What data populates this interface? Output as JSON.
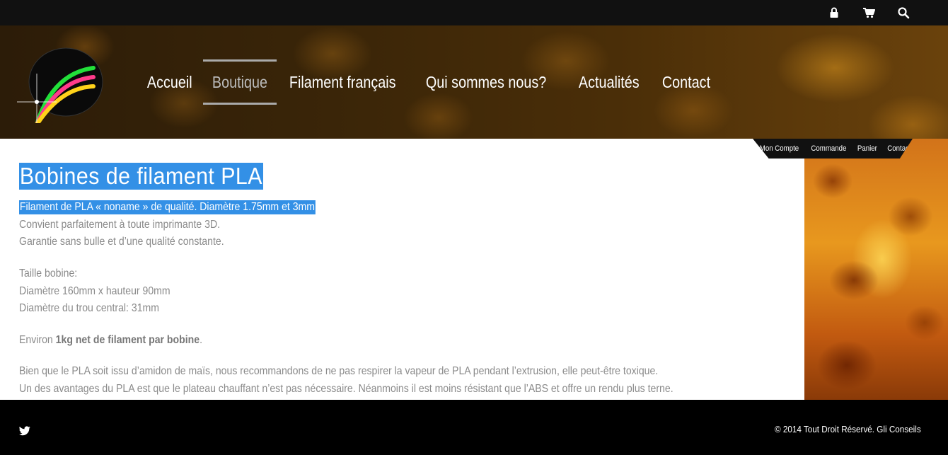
{
  "topbar": {
    "icons": [
      "lock-icon",
      "cart-icon",
      "search-icon"
    ]
  },
  "nav": {
    "items": [
      {
        "label": "Accueil"
      },
      {
        "label": "Boutique"
      },
      {
        "label": "Filament français"
      },
      {
        "label": "Qui sommes nous?"
      },
      {
        "label": "Actualités"
      },
      {
        "label": "Contact"
      }
    ],
    "active": "Boutique"
  },
  "account_links": {
    "items": [
      "Mon Compte",
      "Commande",
      "Panier",
      "Contact"
    ]
  },
  "content": {
    "title": "Bobines de filament PLA",
    "subtitle": "Filament de PLA « noname » de qualité. Diamètre 1.75mm et 3mm",
    "lines": [
      "Convient parfaitement à toute imprimante 3D.",
      "Garantie sans bulle et d’une qualité constante.",
      "Taille bobine:",
      "Diamètre 160mm x hauteur 90mm",
      "Diamètre du trou central: 31mm"
    ],
    "weight_prefix": "Environ ",
    "weight_bold": "1kg net de filament par bobine",
    "weight_suffix": ".",
    "notes": [
      "Bien que le PLA soit issu d’amidon de maïs, nous recommandons de ne pas respirer la vapeur de PLA pendant l’extrusion, elle peut-être toxique.",
      "Un des avantages du PLA est que le plateau chauffant n’est pas nécessaire. Néanmoins il est moins résistant que l’ABS et offre un rendu plus terne."
    ]
  },
  "footer": {
    "copyright": "© 2014 Tout Droit Réservé. Gli Conseils"
  },
  "colors": {
    "selection": "#3390e6",
    "topbar": "#111111",
    "footer": "#000000",
    "text_muted": "#8a8a8a"
  }
}
